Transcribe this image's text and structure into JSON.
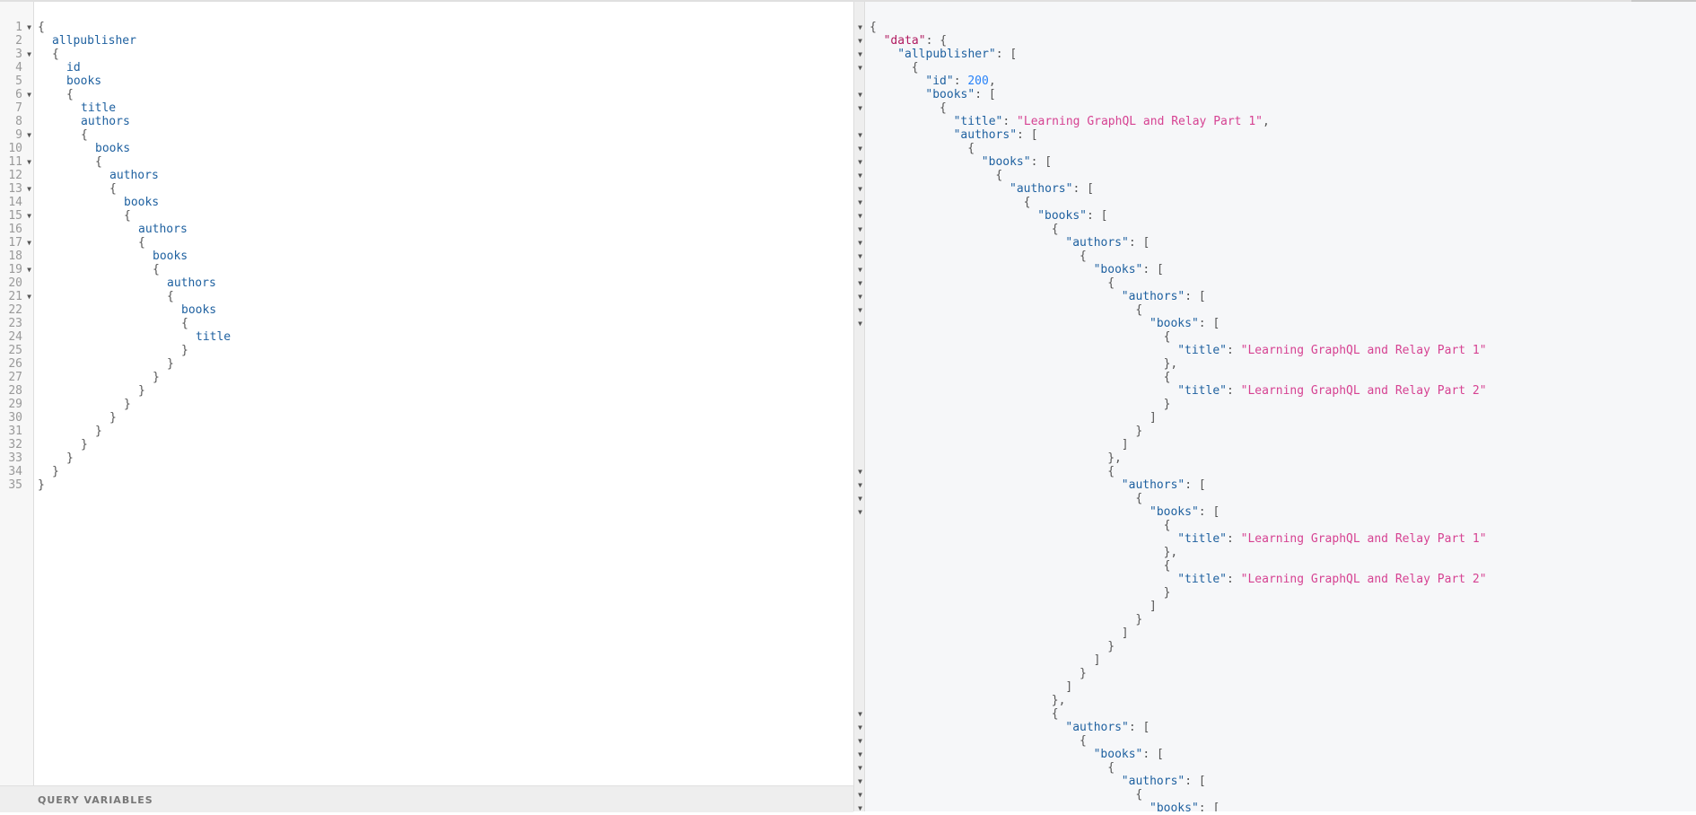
{
  "query_editor": {
    "lines": [
      {
        "n": "1",
        "fold": true,
        "indent": 0,
        "text": "{",
        "kind": "punc"
      },
      {
        "n": "2",
        "fold": false,
        "indent": 1,
        "text": "allpublisher",
        "kind": "field"
      },
      {
        "n": "3",
        "fold": true,
        "indent": 1,
        "text": "{",
        "kind": "punc"
      },
      {
        "n": "4",
        "fold": false,
        "indent": 2,
        "text": "id",
        "kind": "field"
      },
      {
        "n": "5",
        "fold": false,
        "indent": 2,
        "text": "books",
        "kind": "field"
      },
      {
        "n": "6",
        "fold": true,
        "indent": 2,
        "text": "{",
        "kind": "punc"
      },
      {
        "n": "7",
        "fold": false,
        "indent": 3,
        "text": "title",
        "kind": "field"
      },
      {
        "n": "8",
        "fold": false,
        "indent": 3,
        "text": "authors",
        "kind": "field"
      },
      {
        "n": "9",
        "fold": true,
        "indent": 3,
        "text": "{",
        "kind": "punc"
      },
      {
        "n": "10",
        "fold": false,
        "indent": 4,
        "text": "books",
        "kind": "field"
      },
      {
        "n": "11",
        "fold": true,
        "indent": 4,
        "text": "{",
        "kind": "punc"
      },
      {
        "n": "12",
        "fold": false,
        "indent": 5,
        "text": "authors",
        "kind": "field"
      },
      {
        "n": "13",
        "fold": true,
        "indent": 5,
        "text": "{",
        "kind": "punc"
      },
      {
        "n": "14",
        "fold": false,
        "indent": 6,
        "text": "books",
        "kind": "field"
      },
      {
        "n": "15",
        "fold": true,
        "indent": 6,
        "text": "{",
        "kind": "punc"
      },
      {
        "n": "16",
        "fold": false,
        "indent": 7,
        "text": "authors",
        "kind": "field"
      },
      {
        "n": "17",
        "fold": true,
        "indent": 7,
        "text": "{",
        "kind": "punc"
      },
      {
        "n": "18",
        "fold": false,
        "indent": 8,
        "text": "books",
        "kind": "field"
      },
      {
        "n": "19",
        "fold": true,
        "indent": 8,
        "text": "{",
        "kind": "punc"
      },
      {
        "n": "20",
        "fold": false,
        "indent": 9,
        "text": "authors",
        "kind": "field"
      },
      {
        "n": "21",
        "fold": true,
        "indent": 9,
        "text": "{",
        "kind": "punc"
      },
      {
        "n": "22",
        "fold": false,
        "indent": 10,
        "text": "books",
        "kind": "field"
      },
      {
        "n": "23",
        "fold": false,
        "indent": 10,
        "text": "{",
        "kind": "punc"
      },
      {
        "n": "24",
        "fold": false,
        "indent": 11,
        "text": "title",
        "kind": "field"
      },
      {
        "n": "25",
        "fold": false,
        "indent": 10,
        "text": "}",
        "kind": "punc"
      },
      {
        "n": "26",
        "fold": false,
        "indent": 9,
        "text": "}",
        "kind": "punc"
      },
      {
        "n": "27",
        "fold": false,
        "indent": 8,
        "text": "}",
        "kind": "punc"
      },
      {
        "n": "28",
        "fold": false,
        "indent": 7,
        "text": "}",
        "kind": "punc"
      },
      {
        "n": "29",
        "fold": false,
        "indent": 6,
        "text": "}",
        "kind": "punc"
      },
      {
        "n": "30",
        "fold": false,
        "indent": 5,
        "text": "}",
        "kind": "punc"
      },
      {
        "n": "31",
        "fold": false,
        "indent": 4,
        "text": "}",
        "kind": "punc"
      },
      {
        "n": "32",
        "fold": false,
        "indent": 3,
        "text": "}",
        "kind": "punc"
      },
      {
        "n": "33",
        "fold": false,
        "indent": 2,
        "text": "}",
        "kind": "punc"
      },
      {
        "n": "34",
        "fold": false,
        "indent": 1,
        "text": "}",
        "kind": "punc"
      },
      {
        "n": "35",
        "fold": false,
        "indent": 0,
        "text": "}",
        "kind": "punc"
      }
    ]
  },
  "query_variables": {
    "title": "QUERY VARIABLES"
  },
  "result": {
    "lines": [
      {
        "fold": true,
        "indent": 0,
        "parts": [
          [
            "p",
            "{"
          ]
        ]
      },
      {
        "fold": true,
        "indent": 1,
        "parts": [
          [
            "r",
            "\"data\""
          ],
          [
            "p",
            ": {"
          ]
        ]
      },
      {
        "fold": true,
        "indent": 2,
        "parts": [
          [
            "k",
            "\"allpublisher\""
          ],
          [
            "p",
            ": ["
          ]
        ]
      },
      {
        "fold": true,
        "indent": 3,
        "parts": [
          [
            "p",
            "{"
          ]
        ]
      },
      {
        "fold": false,
        "indent": 4,
        "parts": [
          [
            "k",
            "\"id\""
          ],
          [
            "p",
            ": "
          ],
          [
            "n",
            "200"
          ],
          [
            "p",
            ","
          ]
        ]
      },
      {
        "fold": true,
        "indent": 4,
        "parts": [
          [
            "k",
            "\"books\""
          ],
          [
            "p",
            ": ["
          ]
        ]
      },
      {
        "fold": true,
        "indent": 5,
        "parts": [
          [
            "p",
            "{"
          ]
        ]
      },
      {
        "fold": false,
        "indent": 6,
        "parts": [
          [
            "k",
            "\"title\""
          ],
          [
            "p",
            ": "
          ],
          [
            "s",
            "\"Learning GraphQL and Relay Part 1\""
          ],
          [
            "p",
            ","
          ]
        ]
      },
      {
        "fold": true,
        "indent": 6,
        "parts": [
          [
            "k",
            "\"authors\""
          ],
          [
            "p",
            ": ["
          ]
        ]
      },
      {
        "fold": true,
        "indent": 7,
        "parts": [
          [
            "p",
            "{"
          ]
        ]
      },
      {
        "fold": true,
        "indent": 8,
        "parts": [
          [
            "k",
            "\"books\""
          ],
          [
            "p",
            ": ["
          ]
        ]
      },
      {
        "fold": true,
        "indent": 9,
        "parts": [
          [
            "p",
            "{"
          ]
        ]
      },
      {
        "fold": true,
        "indent": 10,
        "parts": [
          [
            "k",
            "\"authors\""
          ],
          [
            "p",
            ": ["
          ]
        ]
      },
      {
        "fold": true,
        "indent": 11,
        "parts": [
          [
            "p",
            "{"
          ]
        ]
      },
      {
        "fold": true,
        "indent": 12,
        "parts": [
          [
            "k",
            "\"books\""
          ],
          [
            "p",
            ": ["
          ]
        ]
      },
      {
        "fold": true,
        "indent": 13,
        "parts": [
          [
            "p",
            "{"
          ]
        ]
      },
      {
        "fold": true,
        "indent": 14,
        "parts": [
          [
            "k",
            "\"authors\""
          ],
          [
            "p",
            ": ["
          ]
        ]
      },
      {
        "fold": true,
        "indent": 15,
        "parts": [
          [
            "p",
            "{"
          ]
        ]
      },
      {
        "fold": true,
        "indent": 16,
        "parts": [
          [
            "k",
            "\"books\""
          ],
          [
            "p",
            ": ["
          ]
        ]
      },
      {
        "fold": true,
        "indent": 17,
        "parts": [
          [
            "p",
            "{"
          ]
        ]
      },
      {
        "fold": true,
        "indent": 18,
        "parts": [
          [
            "k",
            "\"authors\""
          ],
          [
            "p",
            ": ["
          ]
        ]
      },
      {
        "fold": true,
        "indent": 19,
        "parts": [
          [
            "p",
            "{"
          ]
        ]
      },
      {
        "fold": true,
        "indent": 20,
        "parts": [
          [
            "k",
            "\"books\""
          ],
          [
            "p",
            ": ["
          ]
        ]
      },
      {
        "fold": false,
        "indent": 21,
        "parts": [
          [
            "p",
            "{"
          ]
        ]
      },
      {
        "fold": false,
        "indent": 22,
        "parts": [
          [
            "k",
            "\"title\""
          ],
          [
            "p",
            ": "
          ],
          [
            "s",
            "\"Learning GraphQL and Relay Part 1\""
          ]
        ]
      },
      {
        "fold": false,
        "indent": 21,
        "parts": [
          [
            "p",
            "},"
          ]
        ]
      },
      {
        "fold": false,
        "indent": 21,
        "parts": [
          [
            "p",
            "{"
          ]
        ]
      },
      {
        "fold": false,
        "indent": 22,
        "parts": [
          [
            "k",
            "\"title\""
          ],
          [
            "p",
            ": "
          ],
          [
            "s",
            "\"Learning GraphQL and Relay Part 2\""
          ]
        ]
      },
      {
        "fold": false,
        "indent": 21,
        "parts": [
          [
            "p",
            "}"
          ]
        ]
      },
      {
        "fold": false,
        "indent": 20,
        "parts": [
          [
            "p",
            "]"
          ]
        ]
      },
      {
        "fold": false,
        "indent": 19,
        "parts": [
          [
            "p",
            "}"
          ]
        ]
      },
      {
        "fold": false,
        "indent": 18,
        "parts": [
          [
            "p",
            "]"
          ]
        ]
      },
      {
        "fold": false,
        "indent": 17,
        "parts": [
          [
            "p",
            "},"
          ]
        ]
      },
      {
        "fold": true,
        "indent": 17,
        "parts": [
          [
            "p",
            "{"
          ]
        ]
      },
      {
        "fold": true,
        "indent": 18,
        "parts": [
          [
            "k",
            "\"authors\""
          ],
          [
            "p",
            ": ["
          ]
        ]
      },
      {
        "fold": true,
        "indent": 19,
        "parts": [
          [
            "p",
            "{"
          ]
        ]
      },
      {
        "fold": true,
        "indent": 20,
        "parts": [
          [
            "k",
            "\"books\""
          ],
          [
            "p",
            ": ["
          ]
        ]
      },
      {
        "fold": false,
        "indent": 21,
        "parts": [
          [
            "p",
            "{"
          ]
        ]
      },
      {
        "fold": false,
        "indent": 22,
        "parts": [
          [
            "k",
            "\"title\""
          ],
          [
            "p",
            ": "
          ],
          [
            "s",
            "\"Learning GraphQL and Relay Part 1\""
          ]
        ]
      },
      {
        "fold": false,
        "indent": 21,
        "parts": [
          [
            "p",
            "},"
          ]
        ]
      },
      {
        "fold": false,
        "indent": 21,
        "parts": [
          [
            "p",
            "{"
          ]
        ]
      },
      {
        "fold": false,
        "indent": 22,
        "parts": [
          [
            "k",
            "\"title\""
          ],
          [
            "p",
            ": "
          ],
          [
            "s",
            "\"Learning GraphQL and Relay Part 2\""
          ]
        ]
      },
      {
        "fold": false,
        "indent": 21,
        "parts": [
          [
            "p",
            "}"
          ]
        ]
      },
      {
        "fold": false,
        "indent": 20,
        "parts": [
          [
            "p",
            "]"
          ]
        ]
      },
      {
        "fold": false,
        "indent": 19,
        "parts": [
          [
            "p",
            "}"
          ]
        ]
      },
      {
        "fold": false,
        "indent": 18,
        "parts": [
          [
            "p",
            "]"
          ]
        ]
      },
      {
        "fold": false,
        "indent": 17,
        "parts": [
          [
            "p",
            "}"
          ]
        ]
      },
      {
        "fold": false,
        "indent": 16,
        "parts": [
          [
            "p",
            "]"
          ]
        ]
      },
      {
        "fold": false,
        "indent": 15,
        "parts": [
          [
            "p",
            "}"
          ]
        ]
      },
      {
        "fold": false,
        "indent": 14,
        "parts": [
          [
            "p",
            "]"
          ]
        ]
      },
      {
        "fold": false,
        "indent": 13,
        "parts": [
          [
            "p",
            "},"
          ]
        ]
      },
      {
        "fold": true,
        "indent": 13,
        "parts": [
          [
            "p",
            "{"
          ]
        ]
      },
      {
        "fold": true,
        "indent": 14,
        "parts": [
          [
            "k",
            "\"authors\""
          ],
          [
            "p",
            ": ["
          ]
        ]
      },
      {
        "fold": true,
        "indent": 15,
        "parts": [
          [
            "p",
            "{"
          ]
        ]
      },
      {
        "fold": true,
        "indent": 16,
        "parts": [
          [
            "k",
            "\"books\""
          ],
          [
            "p",
            ": ["
          ]
        ]
      },
      {
        "fold": true,
        "indent": 17,
        "parts": [
          [
            "p",
            "{"
          ]
        ]
      },
      {
        "fold": true,
        "indent": 18,
        "parts": [
          [
            "k",
            "\"authors\""
          ],
          [
            "p",
            ": ["
          ]
        ]
      },
      {
        "fold": true,
        "indent": 19,
        "parts": [
          [
            "p",
            "{"
          ]
        ]
      },
      {
        "fold": true,
        "indent": 20,
        "parts": [
          [
            "k",
            "\"books\""
          ],
          [
            "p",
            ": ["
          ]
        ]
      }
    ]
  },
  "colors": {
    "field": "#1f61a0",
    "root_key": "#b11a60",
    "string": "#d64292",
    "number": "#2882f9",
    "punctuation": "#555555",
    "result_bg": "#f6f7f9"
  },
  "icons": {
    "fold": "fold-arrow-icon"
  }
}
